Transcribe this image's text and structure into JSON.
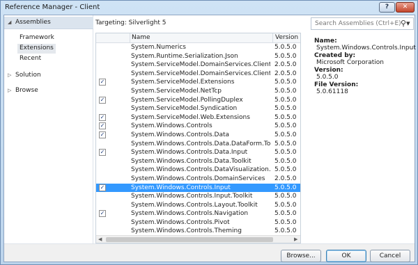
{
  "window": {
    "title": "Reference Manager - Client",
    "help_label": "?",
    "close_label": "✕"
  },
  "nav": {
    "assemblies": "Assemblies",
    "assemblies_items": [
      "Framework",
      "Extensions",
      "Recent"
    ],
    "solution": "Solution",
    "browse": "Browse"
  },
  "targeting": "Targeting: Silverlight 5",
  "search": {
    "placeholder": "Search Assemblies (Ctrl+E)",
    "icon": "search-icon"
  },
  "list": {
    "columns": {
      "name": "Name",
      "version": "Version"
    },
    "rows": [
      {
        "name": "System.Numerics",
        "version": "5.0.5.0",
        "checked": false
      },
      {
        "name": "System.Runtime.Serialization.Json",
        "version": "5.0.5.0",
        "checked": false
      },
      {
        "name": "System.ServiceModel.DomainServices.Client",
        "version": "2.0.5.0",
        "checked": false
      },
      {
        "name": "System.ServiceModel.DomainServices.Client....",
        "version": "2.0.5.0",
        "checked": false
      },
      {
        "name": "System.ServiceModel.Extensions",
        "version": "5.0.5.0",
        "checked": true
      },
      {
        "name": "System.ServiceModel.NetTcp",
        "version": "5.0.5.0",
        "checked": false
      },
      {
        "name": "System.ServiceModel.PollingDuplex",
        "version": "5.0.5.0",
        "checked": true
      },
      {
        "name": "System.ServiceModel.Syndication",
        "version": "5.0.5.0",
        "checked": false
      },
      {
        "name": "System.ServiceModel.Web.Extensions",
        "version": "5.0.5.0",
        "checked": true
      },
      {
        "name": "System.Windows.Controls",
        "version": "5.0.5.0",
        "checked": true
      },
      {
        "name": "System.Windows.Controls.Data",
        "version": "5.0.5.0",
        "checked": true
      },
      {
        "name": "System.Windows.Controls.Data.DataForm.Too...",
        "version": "5.0.5.0",
        "checked": false
      },
      {
        "name": "System.Windows.Controls.Data.Input",
        "version": "5.0.5.0",
        "checked": true
      },
      {
        "name": "System.Windows.Controls.Data.Toolkit",
        "version": "5.0.5.0",
        "checked": false
      },
      {
        "name": "System.Windows.Controls.DataVisualization.T...",
        "version": "5.0.5.0",
        "checked": false
      },
      {
        "name": "System.Windows.Controls.DomainServices",
        "version": "2.0.5.0",
        "checked": false
      },
      {
        "name": "System.Windows.Controls.Input",
        "version": "5.0.5.0",
        "checked": true,
        "selected": true
      },
      {
        "name": "System.Windows.Controls.Input.Toolkit",
        "version": "5.0.5.0",
        "checked": false
      },
      {
        "name": "System.Windows.Controls.Layout.Toolkit",
        "version": "5.0.5.0",
        "checked": false
      },
      {
        "name": "System.Windows.Controls.Navigation",
        "version": "5.0.5.0",
        "checked": true
      },
      {
        "name": "System.Windows.Controls.Pivot",
        "version": "5.0.5.0",
        "checked": false
      },
      {
        "name": "System.Windows.Controls.Theming",
        "version": "5.0.5.0",
        "checked": false
      }
    ]
  },
  "details": {
    "name_label": "Name:",
    "name_value": "System.Windows.Controls.Input",
    "created_label": "Created by:",
    "created_value": "Microsoft Corporation",
    "version_label": "Version:",
    "version_value": "5.0.5.0",
    "file_version_label": "File Version:",
    "file_version_value": "5.0.61118"
  },
  "footer": {
    "browse_label": "Browse...",
    "ok_label": "OK",
    "cancel_label": "Cancel"
  },
  "colors": {
    "selection": "#3399ff",
    "title_bar": "#cfe3f5",
    "close": "#c4462c"
  }
}
